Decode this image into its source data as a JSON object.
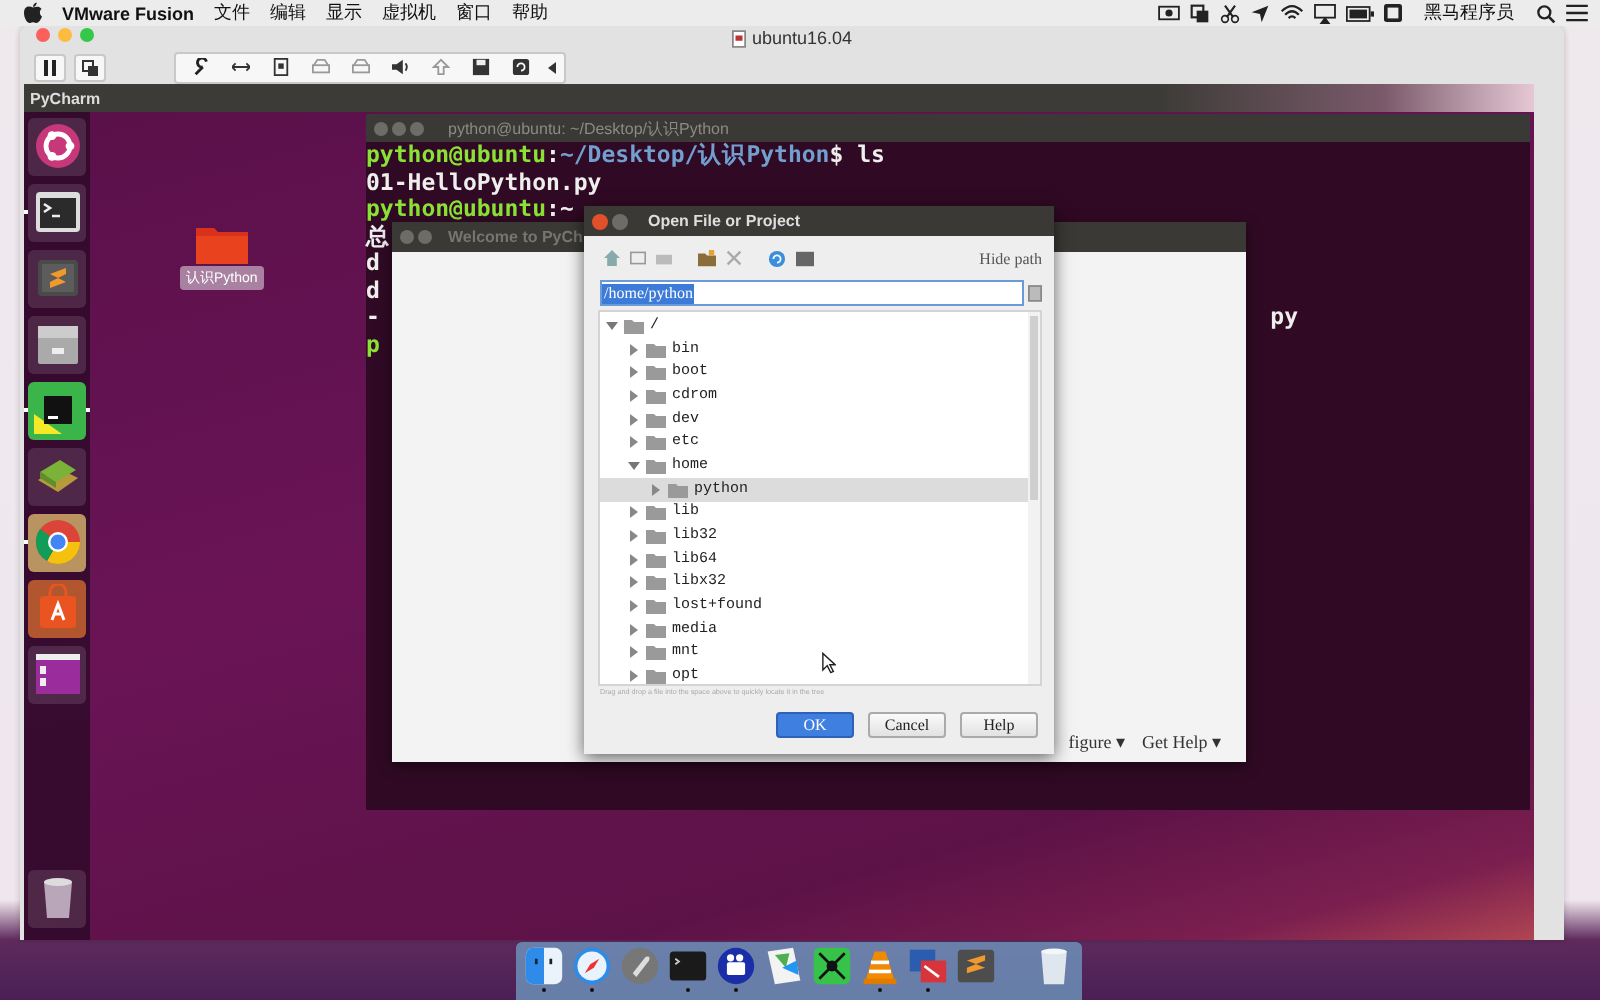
{
  "menubar": {
    "app": "VMware Fusion",
    "menus": [
      "文件",
      "编辑",
      "显示",
      "虚拟机",
      "窗口",
      "帮助"
    ],
    "user": "黑马程序员"
  },
  "vm_window": {
    "title": "ubuntu16.04"
  },
  "ubuntu_topbar": {
    "title": "PyCharm"
  },
  "launcher": [
    {
      "kind": "ubuntu",
      "running": false
    },
    {
      "kind": "terminal",
      "running": true
    },
    {
      "kind": "sublime",
      "running": false
    },
    {
      "kind": "archive",
      "running": false
    },
    {
      "kind": "pycharm",
      "running": true
    },
    {
      "kind": "books",
      "running": false
    },
    {
      "kind": "chrome",
      "running": true
    },
    {
      "kind": "software",
      "running": false
    },
    {
      "kind": "workspace",
      "running": false
    },
    {
      "kind": "trash",
      "running": false
    }
  ],
  "desktop_icons": [
    {
      "label": "认识Python"
    }
  ],
  "terminal": {
    "title": "python@ubuntu: ~/Desktop/认识Python",
    "lines": [
      {
        "segments": [
          {
            "text": "python@ubuntu",
            "kind": "user"
          },
          {
            "text": ":",
            "kind": "plain"
          },
          {
            "text": "~/Desktop/认识Python",
            "kind": "path"
          },
          {
            "text": "$ ls",
            "kind": "plain"
          }
        ]
      },
      {
        "segments": [
          {
            "text": "01-HelloPython.py",
            "kind": "plain"
          }
        ]
      },
      {
        "segments": [
          {
            "text": "python@ubuntu",
            "kind": "user"
          },
          {
            "text": ":~",
            "kind": "plain"
          }
        ]
      },
      {
        "segments": [
          {
            "text": "总",
            "kind": "plain"
          }
        ]
      },
      {
        "segments": [
          {
            "text": "d",
            "kind": "plain"
          }
        ]
      },
      {
        "segments": [
          {
            "text": "d",
            "kind": "plain"
          }
        ]
      },
      {
        "segments": [
          {
            "text": "-",
            "kind": "plain"
          }
        ],
        "tail": "py"
      },
      {
        "segments": [
          {
            "text": "p",
            "kind": "user"
          }
        ]
      }
    ]
  },
  "welcome": {
    "title": "Welcome to PyCh",
    "links": [
      "figure ▾",
      "Get Help ▾"
    ]
  },
  "dialog": {
    "title": "Open File or Project",
    "hide_path": "Hide path",
    "path": "/home/python",
    "tree": [
      {
        "name": "/",
        "expanded": true,
        "selected": false,
        "children": [
          {
            "name": "bin",
            "expanded": false,
            "selected": false
          },
          {
            "name": "boot",
            "expanded": false,
            "selected": false
          },
          {
            "name": "cdrom",
            "expanded": false,
            "selected": false
          },
          {
            "name": "dev",
            "expanded": false,
            "selected": false
          },
          {
            "name": "etc",
            "expanded": false,
            "selected": false
          },
          {
            "name": "home",
            "expanded": true,
            "selected": false,
            "children": [
              {
                "name": "python",
                "expanded": false,
                "selected": true
              }
            ]
          },
          {
            "name": "lib",
            "expanded": false,
            "selected": false
          },
          {
            "name": "lib32",
            "expanded": false,
            "selected": false
          },
          {
            "name": "lib64",
            "expanded": false,
            "selected": false
          },
          {
            "name": "libx32",
            "expanded": false,
            "selected": false
          },
          {
            "name": "lost+found",
            "expanded": false,
            "selected": false
          },
          {
            "name": "media",
            "expanded": false,
            "selected": false
          },
          {
            "name": "mnt",
            "expanded": false,
            "selected": false
          },
          {
            "name": "opt",
            "expanded": false,
            "selected": false
          }
        ]
      }
    ],
    "hint": "Drag and drop a file into the space above to quickly locate it in the tree",
    "buttons": [
      {
        "label": "OK",
        "kind": "primary"
      },
      {
        "label": "Cancel",
        "kind": "normal"
      },
      {
        "label": "Help",
        "kind": "normal"
      }
    ]
  },
  "dock": [
    {
      "kind": "finder",
      "running": true
    },
    {
      "kind": "safari",
      "running": true
    },
    {
      "kind": "launchpad",
      "running": false
    },
    {
      "kind": "terminal",
      "running": true
    },
    {
      "kind": "video",
      "running": true
    },
    {
      "kind": "maps",
      "running": false
    },
    {
      "kind": "mindmap",
      "running": false
    },
    {
      "kind": "vlc",
      "running": true
    },
    {
      "kind": "remote",
      "running": true
    },
    {
      "kind": "sublime",
      "running": false
    },
    {
      "kind": "trash",
      "running": false
    }
  ]
}
